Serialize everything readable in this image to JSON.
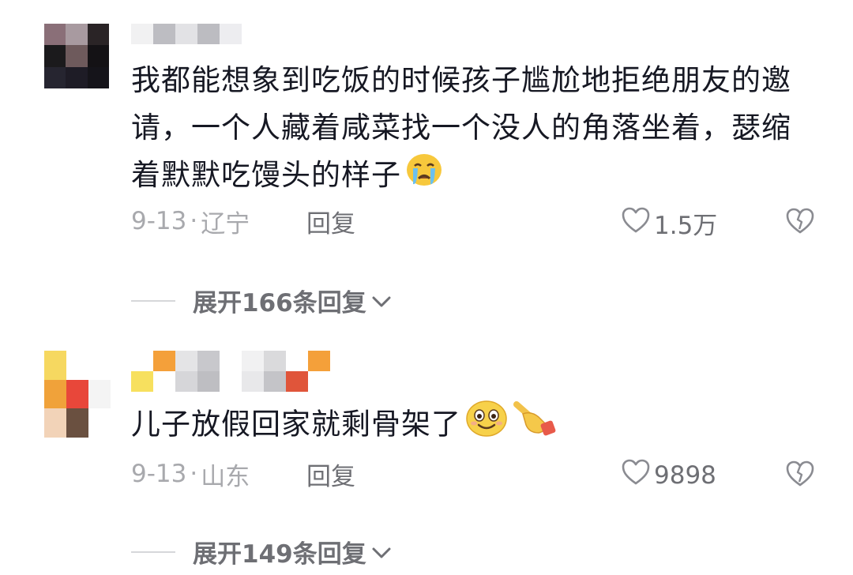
{
  "comments": [
    {
      "text": "我都能想象到吃饭的时候孩子尴尬地拒绝朋友的邀请，一个人藏着咸菜找一个没人的角落坐着，瑟缩着默默吃馒头的样子",
      "emoji": "loudly-crying-face",
      "date": "9-13",
      "location": "辽宁",
      "reply_label": "回复",
      "likes": "1.5万",
      "expand_label": "展开166条回复"
    },
    {
      "text": "儿子放假回家就剩骨架了",
      "emoji": "smiling-face",
      "emoji2": "pointing-hand",
      "date": "9-13",
      "location": "山东",
      "reply_label": "回复",
      "likes": "9898",
      "expand_label": "展开149条回复"
    }
  ],
  "separator": "·"
}
